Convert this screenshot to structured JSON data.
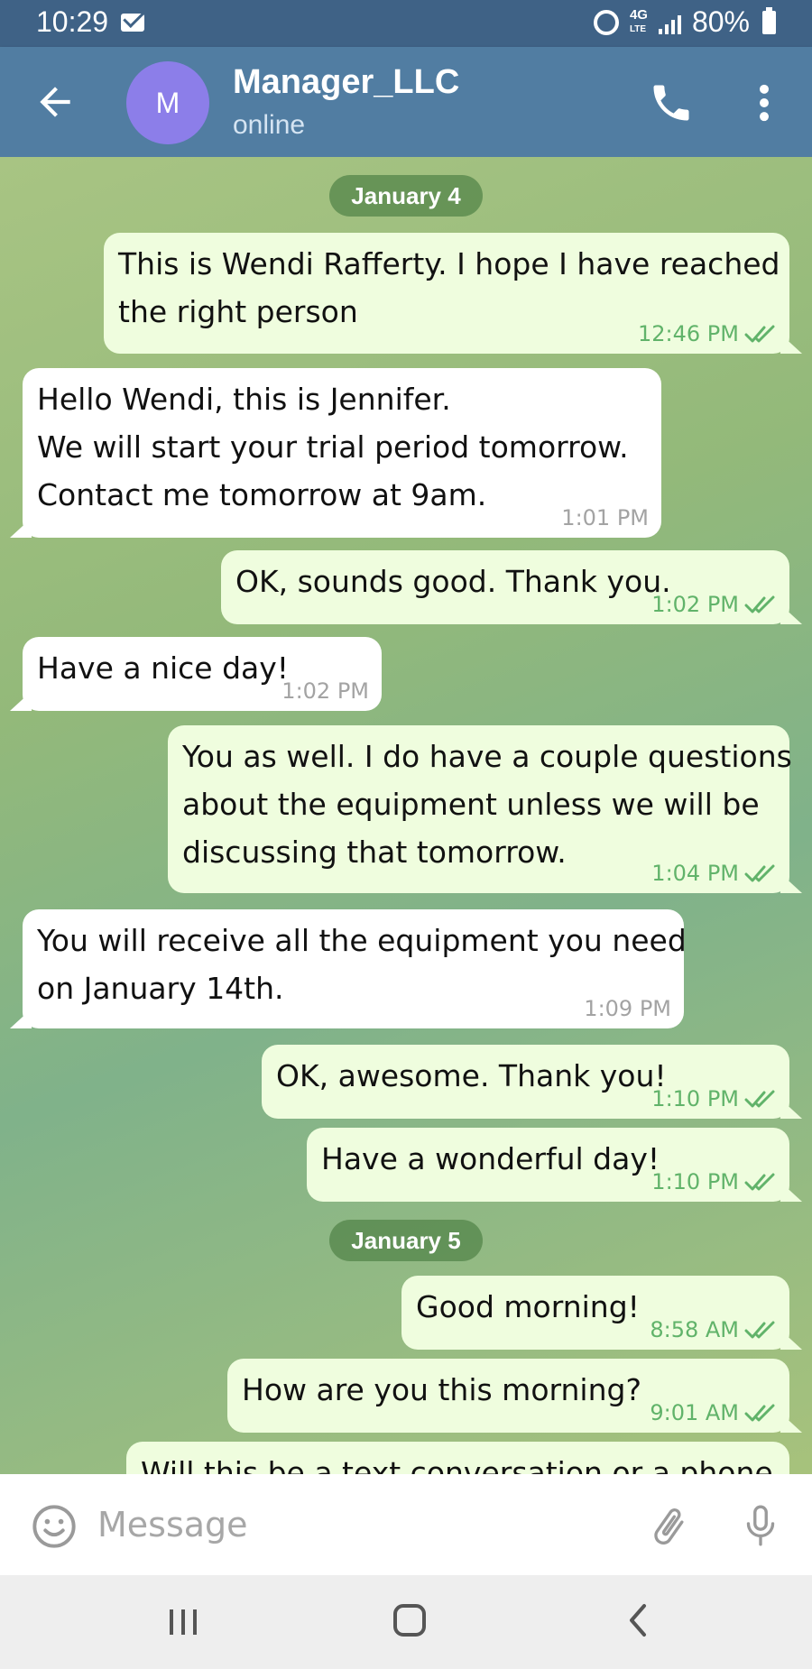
{
  "status_bar": {
    "time": "10:29",
    "network": "4G",
    "network_sub": "LTE",
    "battery": "80%"
  },
  "header": {
    "avatar_letter": "M",
    "title": "Manager_LLC",
    "status": "online"
  },
  "chat": {
    "dates": [
      "January 4",
      "January 5"
    ],
    "messages": [
      {
        "text": "This is Wendi Rafferty. I hope I have reached\nthe right person",
        "time": "12:46 PM"
      },
      {
        "text": "Hello Wendi, this is Jennifer.\nWe will start your trial period tomorrow.\nContact me tomorrow at 9am.",
        "time": "1:01 PM"
      },
      {
        "text": "OK, sounds good. Thank you.",
        "time": "1:02 PM"
      },
      {
        "text": "Have a nice day!",
        "time": "1:02 PM"
      },
      {
        "text": "You as well. I do have a couple questions\nabout the equipment unless we will be\ndiscussing that tomorrow.",
        "time": "1:04 PM"
      },
      {
        "text": "You will receive all the equipment you need\non January 14th.",
        "time": "1:09 PM"
      },
      {
        "text": "OK, awesome. Thank you!",
        "time": "1:10 PM"
      },
      {
        "text": "Have a wonderful day!",
        "time": "1:10 PM"
      },
      {
        "text": "Good morning!",
        "time": "8:58 AM"
      },
      {
        "text": "How are you this morning?",
        "time": "9:01 AM"
      },
      {
        "text": "Will this be a text conversation or a phone",
        "time": ""
      }
    ]
  },
  "input": {
    "placeholder": "Message"
  },
  "colors": {
    "header": "#517da2",
    "status_bar": "#3f6286",
    "outgoing_bubble": "#effdde",
    "incoming_bubble": "#ffffff",
    "read_check": "#61b36a",
    "avatar": "#8c7ee9"
  },
  "icons": [
    "back-arrow-icon",
    "phone-icon",
    "more-vert-icon",
    "double-check-icon",
    "emoji-icon",
    "paperclip-icon",
    "microphone-icon",
    "recents-icon",
    "home-icon",
    "nav-back-icon",
    "alarm-icon",
    "mail-icon",
    "signal-icon",
    "battery-icon"
  ]
}
